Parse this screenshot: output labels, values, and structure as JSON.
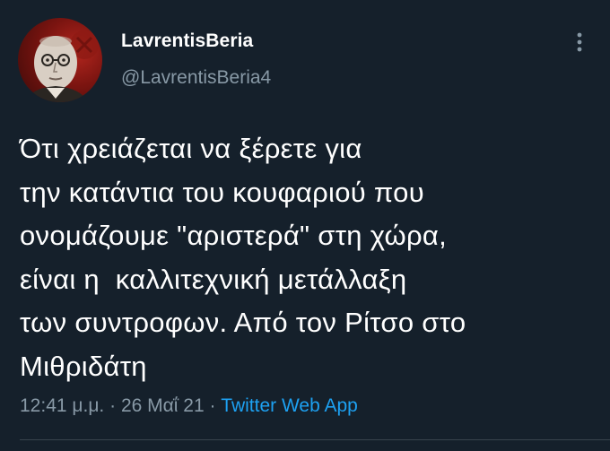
{
  "user": {
    "display_name": "LavrentisBeria",
    "handle": "@LavrentisBeria4",
    "avatar_icon": "profile-avatar-icon"
  },
  "menu": {
    "icon": "more-vertical-icon"
  },
  "tweet": {
    "text": "Ότι χρειάζεται να ξέρετε για\nτην κατάντια του κουφαριού που\nονομάζουμε \"αριστερά\" στη χώρα,\nείναι η  καλλιτεχνική μετάλλαξη\nτων συντροφων. Από τον Ρίτσο στο\nΜιθριδάτη",
    "time": "12:41 μ.μ.",
    "separator1": " · ",
    "date": "26 Μαΐ 21",
    "separator2": " · ",
    "source": "Twitter Web App"
  },
  "colors": {
    "background": "#15202b",
    "text_primary": "#ffffff",
    "text_secondary": "#8899a6",
    "accent": "#1da1f2",
    "divider": "#38444d"
  }
}
